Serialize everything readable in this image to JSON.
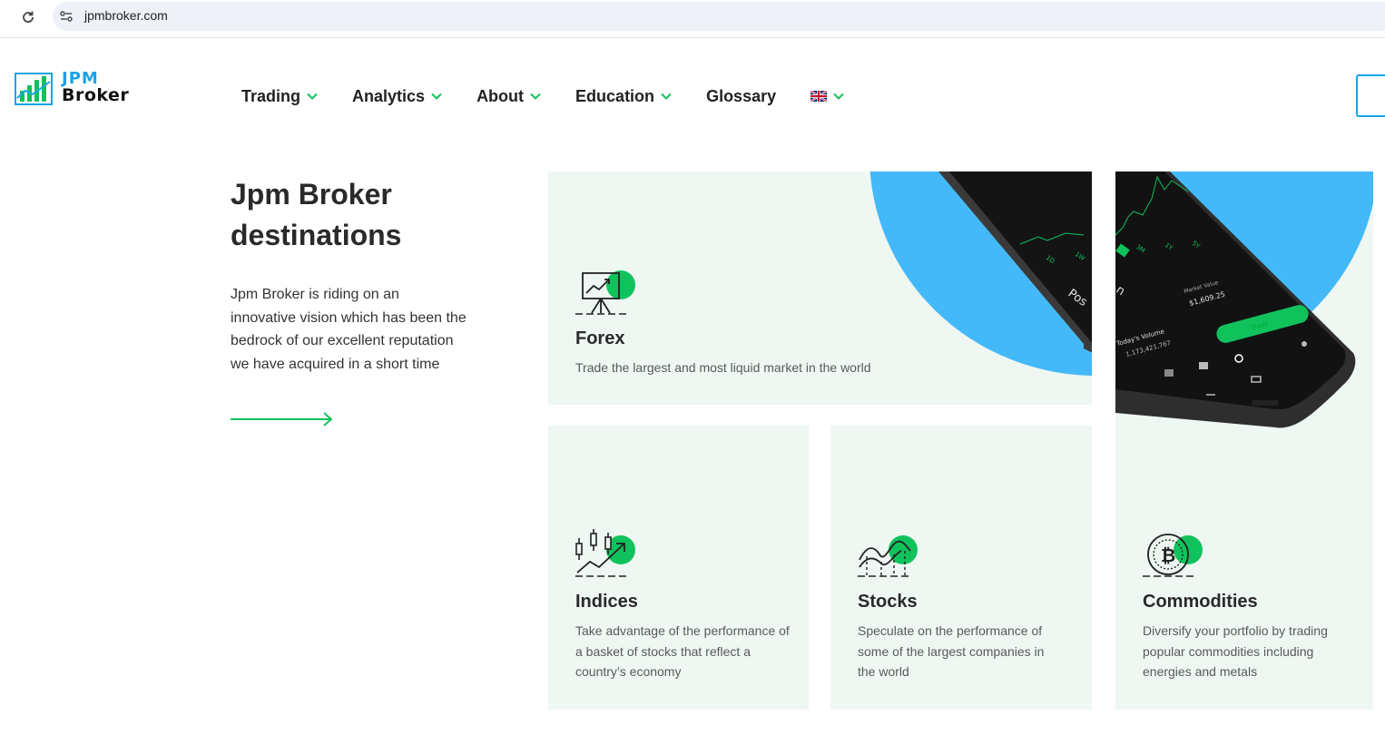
{
  "browser": {
    "url": "jpmbroker.com"
  },
  "logo": {
    "line1": "JPM",
    "line2": "Broker"
  },
  "nav": {
    "items": [
      {
        "label": "Trading",
        "has_dropdown": true
      },
      {
        "label": "Analytics",
        "has_dropdown": true
      },
      {
        "label": "About",
        "has_dropdown": true
      },
      {
        "label": "Education",
        "has_dropdown": true
      },
      {
        "label": "Glossary",
        "has_dropdown": false
      }
    ],
    "language_icon": "uk-flag-icon"
  },
  "intro": {
    "title_line1": "Jpm Broker",
    "title_line2": "destinations",
    "text": "Jpm Broker is riding on an innovative vision which has been the bedrock of our excellent reputation we have acquired in a short time"
  },
  "cards": {
    "forex": {
      "title": "Forex",
      "desc": "Trade the largest and most liquid market in the world",
      "icon": "presentation-chart-icon"
    },
    "indices": {
      "title": "Indices",
      "desc": "Take advantage of the performance of a basket of stocks that reflect a country’s economy",
      "icon": "candlestick-icon"
    },
    "stocks": {
      "title": "Stocks",
      "desc": "Speculate on the performance of some of the largest companies in the world",
      "icon": "stock-waves-icon"
    },
    "commodities": {
      "title": "Commodities",
      "desc": "Diversify your portfolio by trading popular commodities including energies and metals",
      "icon": "bitcoin-coin-icon"
    }
  },
  "phone": {
    "tabs_left": [
      "1D",
      "1W"
    ],
    "tabs_right": [
      "3M",
      "1Y",
      "5Y"
    ],
    "position_label": "Pos",
    "position_label_right": "n",
    "market_value_label": "Market Value",
    "market_value": "$1,609.25",
    "trade_button": "Trade",
    "volume_label": "Today's Volume",
    "volume_value": "1,173,421,767"
  },
  "colors": {
    "accent_green": "#10c25c",
    "brand_blue": "#1aa3e8",
    "card_bg": "#eef7f1",
    "circle_blue": "#44b9f9"
  }
}
